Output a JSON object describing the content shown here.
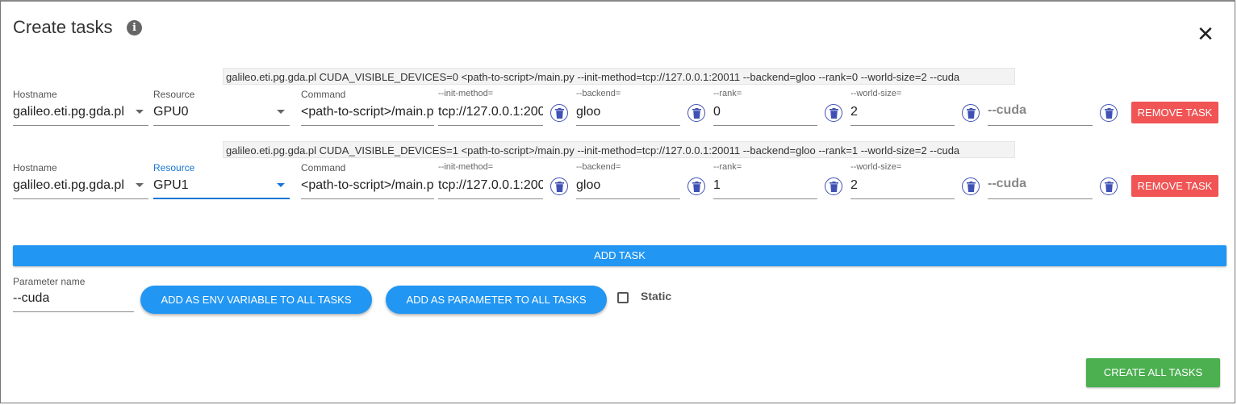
{
  "dialog": {
    "title": "Create tasks",
    "info_icon": "info-icon",
    "close_icon": "close-icon",
    "close_glyph": "✕"
  },
  "tasks": [
    {
      "preview": "galileo.eti.pg.gda.pl CUDA_VISIBLE_DEVICES=0 <path-to-script>/main.py --init-method=tcp://127.0.0.1:20011 --backend=gloo --rank=0 --world-size=2 --cuda",
      "hostname_label": "Hostname",
      "hostname": "galileo.eti.pg.gda.pl",
      "resource_label": "Resource",
      "resource": "GPU0",
      "command_label": "Command",
      "command": "<path-to-script>/main.py",
      "params": [
        {
          "label": "--init-method=",
          "value": "tcp://127.0.0.1:20011"
        },
        {
          "label": "--backend=",
          "value": "gloo"
        },
        {
          "label": "--rank=",
          "value": "0"
        },
        {
          "label": "--world-size=",
          "value": "2"
        },
        {
          "label": "",
          "value": "--cuda"
        }
      ],
      "remove_label": "REMOVE TASK"
    },
    {
      "preview": "galileo.eti.pg.gda.pl CUDA_VISIBLE_DEVICES=1 <path-to-script>/main.py --init-method=tcp://127.0.0.1:20011 --backend=gloo --rank=1 --world-size=2 --cuda",
      "hostname_label": "Hostname",
      "hostname": "galileo.eti.pg.gda.pl",
      "resource_label": "Resource",
      "resource": "GPU1",
      "command_label": "Command",
      "command": "<path-to-script>/main.py",
      "params": [
        {
          "label": "--init-method=",
          "value": "tcp://127.0.0.1:20011"
        },
        {
          "label": "--backend=",
          "value": "gloo"
        },
        {
          "label": "--rank=",
          "value": "1"
        },
        {
          "label": "--world-size=",
          "value": "2"
        },
        {
          "label": "",
          "value": "--cuda"
        }
      ],
      "remove_label": "REMOVE TASK"
    }
  ],
  "add_task_label": "ADD TASK",
  "parameter": {
    "label": "Parameter name",
    "value": "--cuda",
    "add_env_label": "ADD AS ENV VARIABLE TO ALL TASKS",
    "add_param_label": "ADD AS PARAMETER TO ALL TASKS",
    "static_label": "Static",
    "static_checked": false
  },
  "create_all_label": "CREATE ALL TASKS",
  "colors": {
    "primary": "#2196f3",
    "danger": "#f05454",
    "success": "#4caf50",
    "focus": "#1976d2",
    "delete_icon": "#3f51b5"
  }
}
